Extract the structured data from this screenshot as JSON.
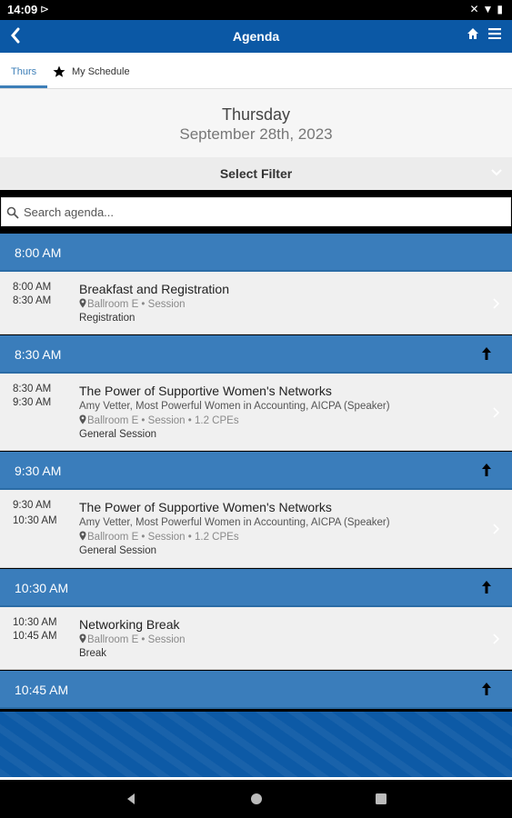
{
  "status": {
    "time": "14:09"
  },
  "appbar": {
    "title": "Agenda"
  },
  "tabs": [
    {
      "label": "Thurs"
    },
    {
      "label": "My Schedule"
    }
  ],
  "date": {
    "day": "Thursday",
    "full": "September 28th, 2023"
  },
  "filter": {
    "label": "Select Filter"
  },
  "search": {
    "placeholder": "Search agenda..."
  },
  "slots": [
    {
      "label": "8:00 AM"
    },
    {
      "label": "8:30 AM"
    },
    {
      "label": "9:30 AM"
    },
    {
      "label": "10:30 AM"
    },
    {
      "label": "10:45 AM"
    }
  ],
  "sessions": [
    {
      "start": "8:00 AM",
      "end": "8:30 AM",
      "title": "Breakfast and Registration",
      "speaker": "",
      "location": "Ballroom E • Session",
      "category": "Registration"
    },
    {
      "start": "8:30 AM",
      "end": "9:30 AM",
      "title": "The Power of Supportive Women's Networks",
      "speaker": "Amy Vetter, Most Powerful Women in Accounting, AICPA (Speaker)",
      "location": "Ballroom E • Session • 1.2 CPEs",
      "category": "General Session"
    },
    {
      "start": "9:30 AM",
      "end": "10:30 AM",
      "title": "The Power of Supportive Women's Networks",
      "speaker": "Amy Vetter, Most Powerful Women in Accounting, AICPA (Speaker)",
      "location": "Ballroom E • Session • 1.2 CPEs",
      "category": "General Session"
    },
    {
      "start": "10:30 AM",
      "end": "10:45 AM",
      "title": "Networking Break",
      "speaker": "",
      "location": "Ballroom E • Session",
      "category": "Break"
    }
  ],
  "colors": {
    "brand": "#0b58a5",
    "slot": "#3a7dbb",
    "tab_active": "#3d7fb8"
  }
}
